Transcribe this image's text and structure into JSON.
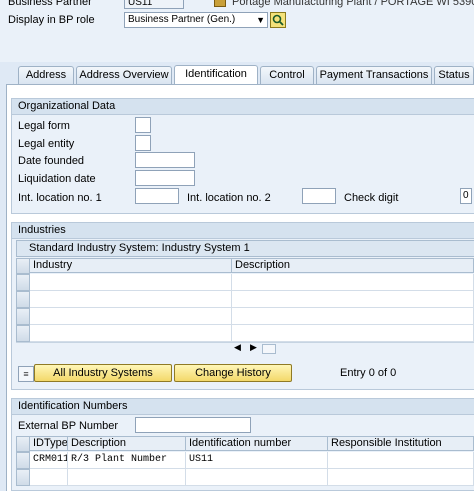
{
  "header": {
    "bp_label": "Business Partner",
    "bp_value": "US11",
    "bp_desc": "Portage Manufacturing Plant / PORTAGE WI 53901",
    "role_label": "Display in BP role",
    "role_value": "Business Partner (Gen.)"
  },
  "tabs": [
    {
      "label": "Address"
    },
    {
      "label": "Address Overview"
    },
    {
      "label": "Identification"
    },
    {
      "label": "Control"
    },
    {
      "label": "Payment Transactions"
    },
    {
      "label": "Status"
    }
  ],
  "active_tab": "Identification",
  "org": {
    "title": "Organizational Data",
    "legal_form": "Legal form",
    "legal_entity": "Legal entity",
    "date_founded": "Date founded",
    "liquidation_date": "Liquidation date",
    "int_loc1": "Int. location no. 1",
    "int_loc2": "Int. location no. 2",
    "check_digit": "Check digit",
    "check_digit_value": "0"
  },
  "industries": {
    "title": "Industries",
    "table_title": "Standard Industry System: Industry System 1",
    "columns": [
      "Industry",
      "Description"
    ],
    "btn_all": "All Industry Systems",
    "btn_history": "Change History",
    "entry": "Entry 0 of 0"
  },
  "ident": {
    "title": "Identification Numbers",
    "ext_bp_label": "External BP Number",
    "columns": [
      "IDType",
      "Description",
      "Identification number",
      "Responsible Institution"
    ],
    "rows": [
      {
        "idtype": "CRM011",
        "description": "R/3 Plant Number",
        "number": "US11",
        "institution": ""
      }
    ]
  },
  "colors": {
    "background": "#dfe9f5",
    "button": "#f3d86a",
    "group_title": "#d5e2ef"
  }
}
